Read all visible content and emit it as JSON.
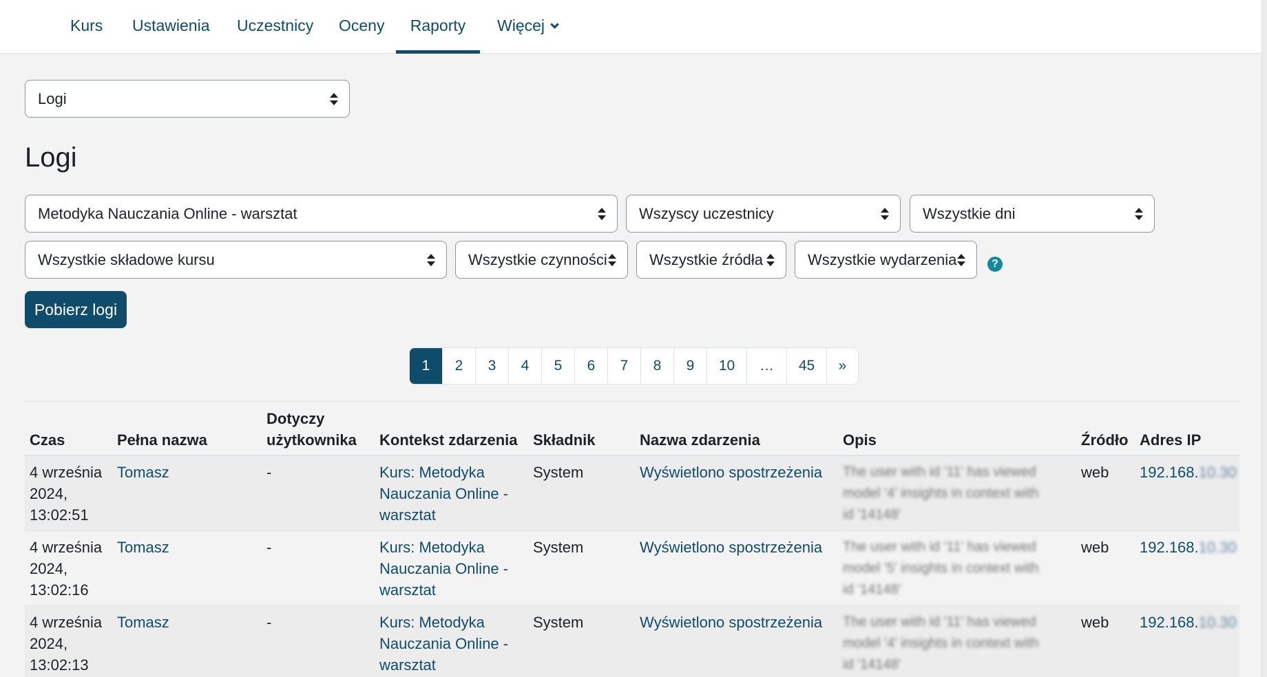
{
  "nav": {
    "tabs": [
      "Kurs",
      "Ustawienia",
      "Uczestnicy",
      "Oceny",
      "Raporty",
      "Więcej"
    ],
    "active": "Raporty"
  },
  "report_select": {
    "value": "Logi"
  },
  "page_title": "Logi",
  "filters": {
    "course": "Metodyka Nauczania Online - warsztat",
    "participants": "Wszyscy uczestnicy",
    "days": "Wszystkie dni",
    "components": "Wszystkie składowe kursu",
    "actions": "Wszystkie czynności",
    "sources": "Wszystkie źródła",
    "events": "Wszystkie wydarzenia"
  },
  "help_icon_glyph": "?",
  "download_button": "Pobierz logi",
  "pagination": {
    "pages": [
      "1",
      "2",
      "3",
      "4",
      "5",
      "6",
      "7",
      "8",
      "9",
      "10",
      "…",
      "45",
      "»"
    ],
    "current": "1"
  },
  "table": {
    "headers": {
      "time": "Czas",
      "fullname": "Pełna nazwa",
      "related_user_1": "Dotyczy",
      "related_user_2": "użytkownika",
      "context": "Kontekst zdarzenia",
      "component": "Składnik",
      "event_name": "Nazwa zdarzenia",
      "description": "Opis",
      "origin": "Źródło",
      "ip": "Adres IP"
    },
    "rows": [
      {
        "time": [
          "4 września",
          "2024,",
          "13:02:51"
        ],
        "fullname": "Tomasz",
        "related_user": "-",
        "context": [
          "Kurs: Metodyka",
          "Nauczania Online -",
          "warsztat"
        ],
        "component": "System",
        "event_name": "Wyświetlono spostrzeżenia",
        "description": [
          "The user with id '11' has viewed",
          "model '4' insights in context with",
          "id '14148'"
        ],
        "origin": "web",
        "ip_visible": "192.168.",
        "ip_hidden": "10.30"
      },
      {
        "time": [
          "4 września",
          "2024,",
          "13:02:16"
        ],
        "fullname": "Tomasz",
        "related_user": "-",
        "context": [
          "Kurs: Metodyka",
          "Nauczania Online -",
          "warsztat"
        ],
        "component": "System",
        "event_name": "Wyświetlono spostrzeżenia",
        "description": [
          "The user with id '11' has viewed",
          "model '5' insights in context with",
          "id '14148'"
        ],
        "origin": "web",
        "ip_visible": "192.168.",
        "ip_hidden": "10.30"
      },
      {
        "time": [
          "4 września",
          "2024,",
          "13:02:13"
        ],
        "fullname": "Tomasz",
        "related_user": "-",
        "context": [
          "Kurs: Metodyka",
          "Nauczania Online -",
          "warsztat"
        ],
        "component": "System",
        "event_name": "Wyświetlono spostrzeżenia",
        "description": [
          "The user with id '11' has viewed",
          "model '4' insights in context with",
          "id '14148'"
        ],
        "origin": "web",
        "ip_visible": "192.168.",
        "ip_hidden": "10.30"
      }
    ]
  }
}
